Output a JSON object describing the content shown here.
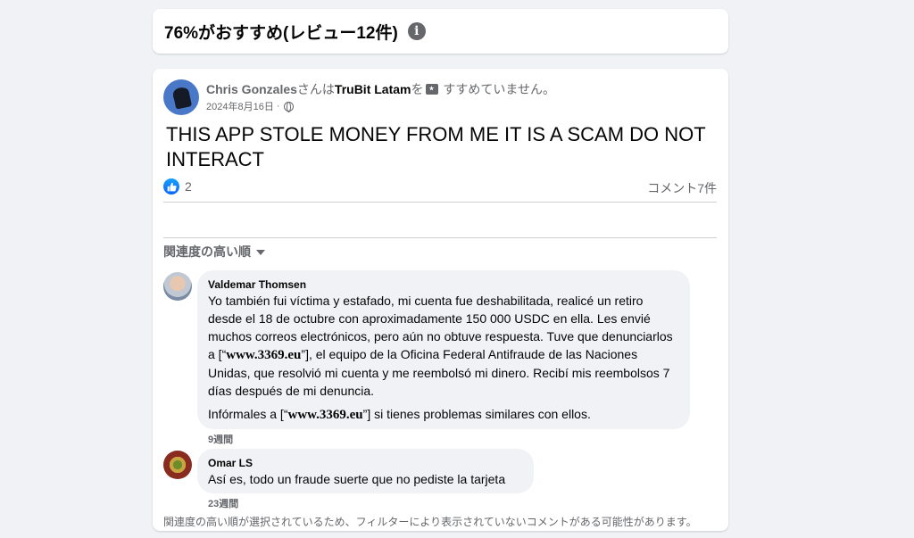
{
  "header": {
    "title": "76%がおすすめ(レビュー12件)",
    "info_icon": "i"
  },
  "post": {
    "author": "Chris Gonzales",
    "action_pre": "さんは",
    "page_name": "TruBit Latam",
    "action_mid": "を",
    "action_post": " すすめていません。",
    "date": "2024年8月16日",
    "separator": "·",
    "body": "THIS APP STOLE MONEY FROM ME IT IS A SCAM DO NOT INTERACT",
    "like_count": "2",
    "comment_count": "コメント7件"
  },
  "comments_section": {
    "sort_label": "関連度の高い順",
    "comments": [
      {
        "name": "Valdemar Thomsen",
        "p1_a": "Yo también fui víctima y estafado, mi cuenta fue deshabilitada, realicé un retiro desde el 18 de octubre con aproximadamente 150 000 USDC en ella. Les envié muchos correos electrónicos, pero aún no obtuve respuesta. Tuve que denunciarlos a [“",
        "p1_site": "www.3369.eu",
        "p1_b": "”], el equipo de la Oficina Federal Antifraude de las Naciones Unidas, que resolvió mi cuenta y me reembolsó mi dinero. Recibí mis reembolsos 7 días después de mi denuncia.",
        "p2_a": "Infórmales a [“",
        "p2_site": "www.3369.eu",
        "p2_b": "”] si tienes problemas similares con ellos.",
        "time": "9週間"
      },
      {
        "name": "Omar LS",
        "text": "Así es, todo un fraude suerte que no pediste la tarjeta",
        "time": "23週間"
      }
    ],
    "footer_note": "関連度の高い順が選択されているため、フィルターにより表示されていないコメントがある可能性があります。"
  },
  "colors": {
    "background": "#f0f2f5",
    "card": "#ffffff",
    "secondary_text": "#65676b",
    "like_blue": "#0866ff"
  }
}
